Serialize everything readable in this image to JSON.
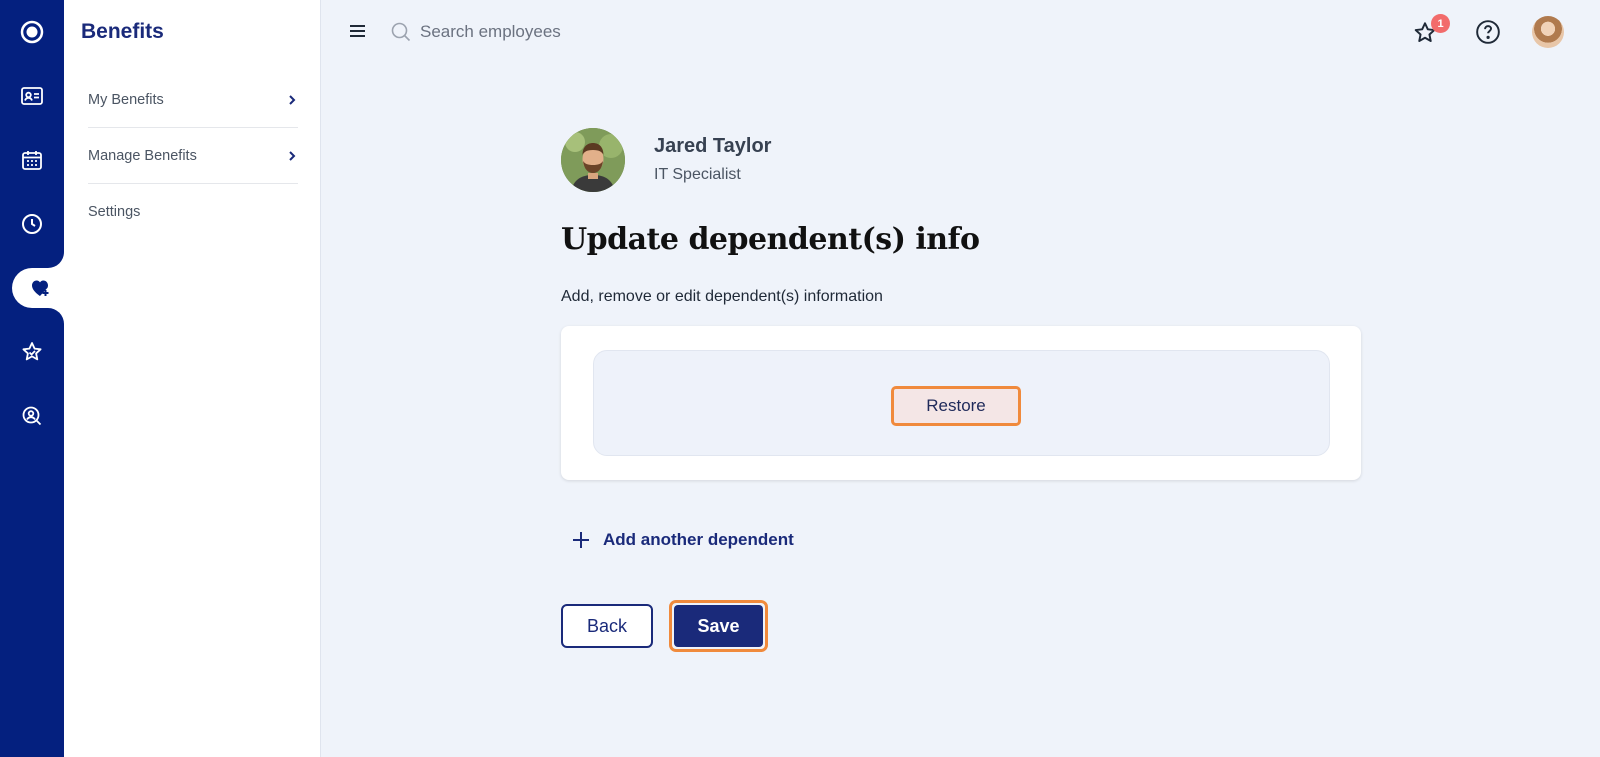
{
  "rail": {
    "items": [
      {
        "icon": "app-logo-icon"
      },
      {
        "icon": "id-card-icon"
      },
      {
        "icon": "calendar-icon"
      },
      {
        "icon": "clock-icon"
      },
      {
        "icon": "heart-plus-icon",
        "active": true
      },
      {
        "icon": "star-icon"
      },
      {
        "icon": "person-search-icon"
      }
    ]
  },
  "sidebar": {
    "title": "Benefits",
    "items": [
      {
        "label": "My Benefits",
        "has_chevron": true
      },
      {
        "label": "Manage Benefits",
        "has_chevron": true
      },
      {
        "label": "Settings",
        "has_chevron": false
      }
    ]
  },
  "topbar": {
    "search_placeholder": "Search employees",
    "notification_count": "1"
  },
  "profile": {
    "name": "Jared Taylor",
    "role": "IT Specialist"
  },
  "main": {
    "title": "Update dependent(s) info",
    "subtitle": "Add, remove or edit dependent(s) information",
    "restore_label": "Restore",
    "add_dependent_label": "Add another dependent",
    "back_label": "Back",
    "save_label": "Save"
  },
  "colors": {
    "rail_bg": "#04207f",
    "brand_navy": "#1a2a7a",
    "page_bg": "#eff3fa",
    "highlight_orange": "#f08a3c",
    "badge_red": "#f26b6b"
  }
}
